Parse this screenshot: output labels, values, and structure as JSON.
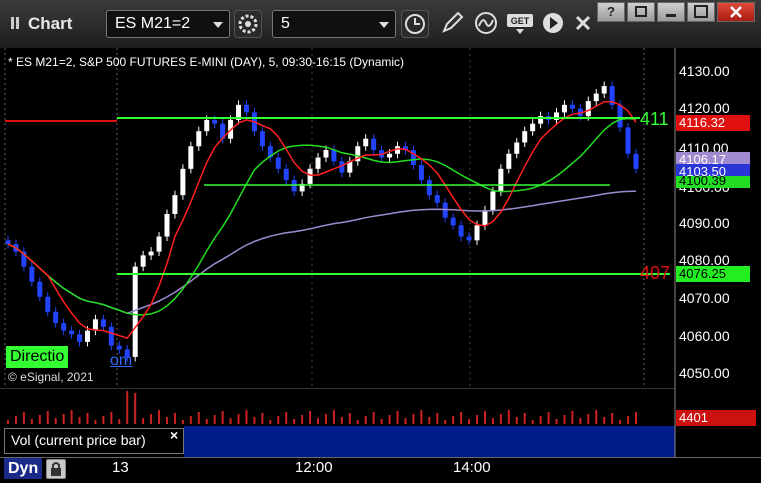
{
  "app": {
    "title": "Chart"
  },
  "toolbar": {
    "symbol": "ES M21=2",
    "interval": "5"
  },
  "chart": {
    "info_line": "* ES M21=2, S&P 500 FUTURES E-MINI (DAY), 5, 09:30-16:15 (Dynamic)",
    "copyright": "© eSignal, 2021",
    "badge_text": "Directio",
    "badge_link": "om",
    "level_upper_text": "411",
    "level_lower_text": "407",
    "price_labels": [
      {
        "text": "4116.32",
        "bg": "#e01010",
        "fg": "#ffffff"
      },
      {
        "text": "4106.17",
        "bg": "#a08ad0",
        "fg": "#ffffff"
      },
      {
        "text": "4103.50",
        "bg": "#2a35d8",
        "fg": "#ffffff"
      },
      {
        "text": "4100.39",
        "bg": "#22dd22",
        "fg": "#000000"
      },
      {
        "text": "4076.25",
        "bg": "#22ee22",
        "fg": "#000000"
      }
    ],
    "y_ticks": [
      "4130.00",
      "4120.00",
      "4110.00",
      "4100.00",
      "4090.00",
      "4080.00",
      "4070.00",
      "4060.00",
      "4050.00"
    ],
    "x_ticks": [
      "13",
      "12:00",
      "14:00"
    ]
  },
  "volume": {
    "legend": "Vol (current price bar)",
    "value": "4401"
  },
  "status": {
    "dyn": "Dyn"
  },
  "colors": {
    "up": "#ffffff",
    "down": "#2244ff",
    "fast_ma": "#ff2020",
    "slow_ma": "#22dd22",
    "vwap": "#a08ad0",
    "level": "#33ff33",
    "volume_bar": "#cc2222"
  }
}
